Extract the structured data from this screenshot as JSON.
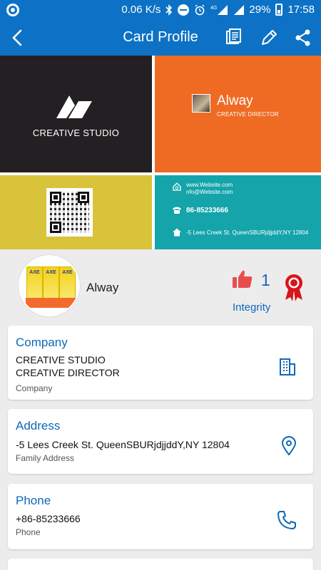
{
  "status_bar": {
    "speed": "0.06 K/s",
    "network": "4G",
    "battery": "29%",
    "time": "17:58"
  },
  "app_bar": {
    "title": "Card Profile",
    "icons": [
      "back-arrow-icon",
      "card-list-icon",
      "edit-pencil-icon",
      "share-icon"
    ]
  },
  "business_card": {
    "company": "CREATIVE STUDIO",
    "name": "Alway",
    "role": "CREATIVE DIRECTOR",
    "website": "www.Website.com",
    "email": "nfo@Website.com",
    "phone": "86-85233666",
    "address": "-5 Lees Creek St. QueenSBURjdjjddY,NY 12804",
    "colors": {
      "dark": "#241f22",
      "orange": "#ef6b24",
      "yellow": "#d8c33b",
      "teal": "#14a4aa"
    }
  },
  "profile": {
    "name": "Alway",
    "likes": "1",
    "integrity_label": "Integrity",
    "avatar_product_label": "AXE"
  },
  "info_cards": {
    "company": {
      "title": "Company",
      "line1": "CREATIVE STUDIO",
      "line2": "CREATIVE DIRECTOR",
      "sub": "Company"
    },
    "address": {
      "title": "Address",
      "value": "-5 Lees Creek St. QueenSBURjdjjddY,NY 12804",
      "sub": "Family Address"
    },
    "phone": {
      "title": "Phone",
      "value": "+86-85233666",
      "sub": "Phone"
    }
  },
  "accent_color": "#1167b8",
  "bar_color": "#0d72c5"
}
